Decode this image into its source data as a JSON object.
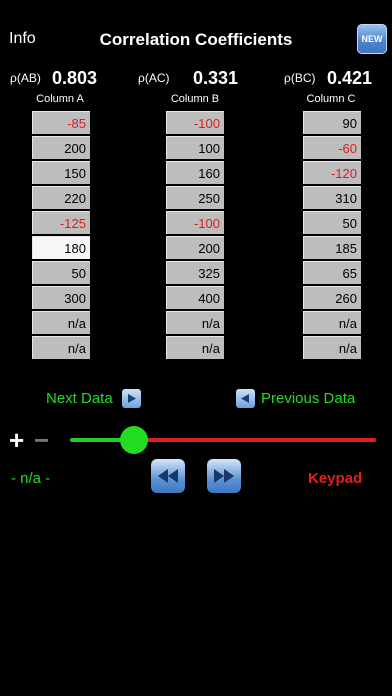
{
  "header": {
    "info_label": "Info",
    "title": "Correlation Coefficients",
    "new_label": "NEW"
  },
  "correlations": [
    {
      "label": "ρ(AB)",
      "value": "0.803"
    },
    {
      "label": "ρ(AC)",
      "value": "0.331"
    },
    {
      "label": "ρ(BC)",
      "value": "0.421"
    }
  ],
  "columns": [
    {
      "name": "Column A",
      "values": [
        "-85",
        "200",
        "150",
        "220",
        "-125",
        "180",
        "50",
        "300",
        "n/a",
        "n/a"
      ]
    },
    {
      "name": "Column B",
      "values": [
        "-100",
        "100",
        "160",
        "250",
        "-100",
        "200",
        "325",
        "400",
        "n/a",
        "n/a"
      ]
    },
    {
      "name": "Column C",
      "values": [
        "90",
        "-60",
        "-120",
        "310",
        "50",
        "185",
        "65",
        "260",
        "n/a",
        "n/a"
      ]
    }
  ],
  "selected_row": 5,
  "navigation": {
    "next_label": "Next Data",
    "previous_label": "Previous Data"
  },
  "slider": {
    "position": 0.21
  },
  "status_text": "- n/a -",
  "keypad_label": "Keypad",
  "colors": {
    "accent_green": "#27d927",
    "accent_red": "#e02020",
    "button_blue": "#5d93d4"
  }
}
